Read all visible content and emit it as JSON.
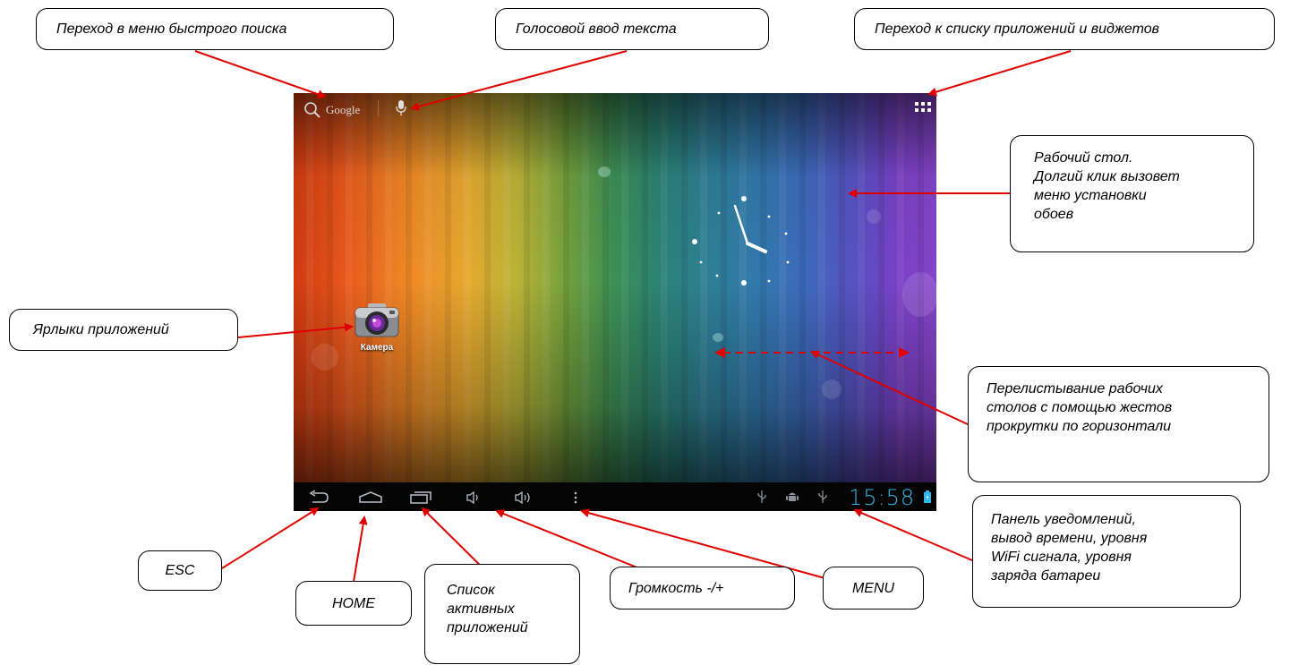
{
  "callouts": {
    "quick_search": "Переход в меню   быстрого поиска",
    "voice_input": "Голосовой ввод текста",
    "apps_widgets": "Переход к списку приложений и виджетов",
    "desktop": "Рабочий стол.\nДолгий клик вызовет\nменю установки\nобоев",
    "app_shortcuts": "Ярлыки приложений",
    "swipe": "Перелистывание рабочих\nстолов с помощью жестов\nпрокрутки по горизонтали",
    "notifications": "Панель уведомлений,\nвывод времени, уровня\nWiFi сигнала, уровня\nзаряда батареи",
    "esc": "ESC",
    "home": "HOME",
    "recent_apps": "Список\nактивных\nприложений",
    "volume": "Громкость -/+",
    "menu": "MENU"
  },
  "screen": {
    "search_label": "Google",
    "camera_label": "Камера",
    "clock": "15:58"
  },
  "icons": {
    "search": "search-icon",
    "mic": "microphone-icon",
    "apps": "apps-grid-icon",
    "back": "back-icon",
    "home": "home-icon",
    "recent": "recent-apps-icon",
    "vol_down": "volume-down-icon",
    "vol_up": "volume-up-icon",
    "menu": "menu-icon",
    "usb1": "usb-icon",
    "android": "android-icon",
    "usb2": "usb-icon",
    "battery": "battery-icon"
  },
  "colors": {
    "arrow": "#e00000",
    "clock": "#33b5e5",
    "navbar": "#050505"
  }
}
